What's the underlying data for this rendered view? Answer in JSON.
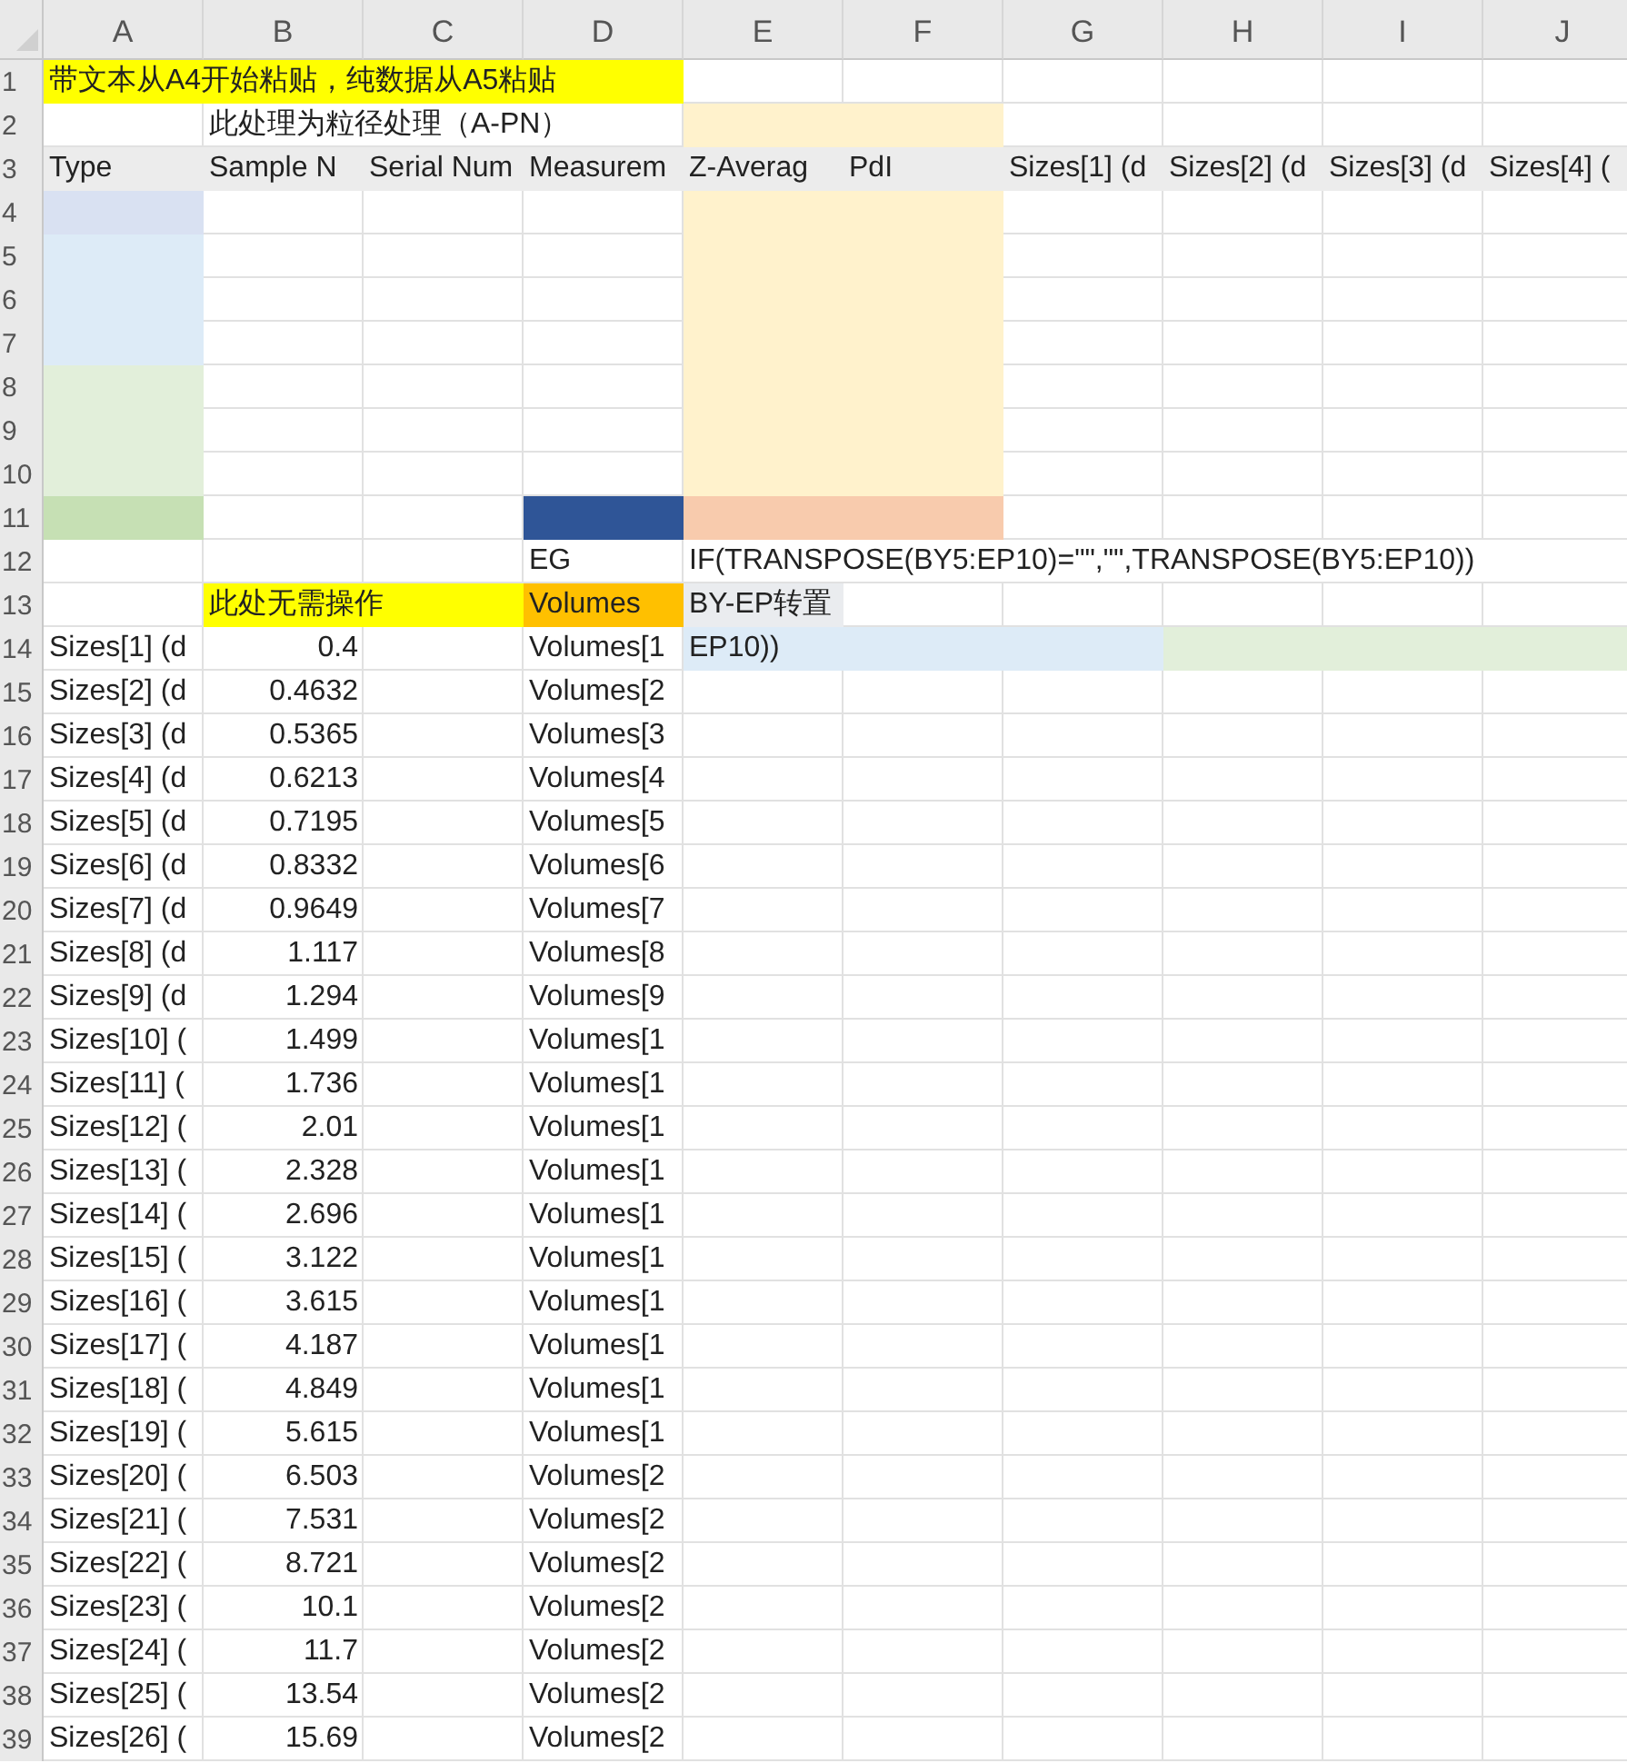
{
  "columns": [
    "A",
    "B",
    "C",
    "D",
    "E",
    "F",
    "G",
    "H",
    "I",
    "J"
  ],
  "rows": [
    {
      "label": "1",
      "cells": [
        {
          "text": "带文本从A4开始粘贴，纯数据从A5粘贴",
          "color": "#ffff00"
        },
        {
          "color": "#ffff00"
        },
        {
          "color": "#ffff00"
        },
        {
          "color": "#ffff00"
        },
        {},
        {},
        {},
        {},
        {},
        {}
      ]
    },
    {
      "label": "2",
      "cells": [
        {},
        {
          "text": "此处理为粒径处理（A-PN）"
        },
        {},
        {},
        {
          "color": "#fff2cc"
        },
        {
          "color": "#fff2cc"
        },
        {},
        {},
        {},
        {}
      ]
    },
    {
      "label": "3",
      "cells": [
        {
          "text": "Type",
          "color": "#ececec"
        },
        {
          "text": "Sample N",
          "color": "#ececec"
        },
        {
          "text": "Serial Num",
          "color": "#ececec"
        },
        {
          "text": "Measurem",
          "color": "#ececec"
        },
        {
          "text": "Z-Averag",
          "color": "#ececec"
        },
        {
          "text": "PdI",
          "color": "#ececec"
        },
        {
          "text": "Sizes[1] (d",
          "color": "#ececec"
        },
        {
          "text": "Sizes[2] (d",
          "color": "#ececec"
        },
        {
          "text": "Sizes[3] (d",
          "color": "#ececec"
        },
        {
          "text": "Sizes[4] (",
          "color": "#ececec"
        }
      ]
    },
    {
      "label": "4",
      "cells": [
        {
          "color": "#d9e1f2"
        },
        {},
        {},
        {},
        {
          "color": "#fff2cc"
        },
        {
          "color": "#fff2cc"
        },
        {},
        {},
        {},
        {}
      ]
    },
    {
      "label": "5",
      "cells": [
        {
          "color": "#ddebf7"
        },
        {},
        {},
        {},
        {
          "color": "#fff2cc"
        },
        {
          "color": "#fff2cc"
        },
        {},
        {},
        {},
        {}
      ]
    },
    {
      "label": "6",
      "cells": [
        {
          "color": "#ddebf7"
        },
        {},
        {},
        {},
        {
          "color": "#fff2cc"
        },
        {
          "color": "#fff2cc"
        },
        {},
        {},
        {},
        {}
      ]
    },
    {
      "label": "7",
      "cells": [
        {
          "color": "#ddebf7"
        },
        {},
        {},
        {},
        {
          "color": "#fff2cc"
        },
        {
          "color": "#fff2cc"
        },
        {},
        {},
        {},
        {}
      ]
    },
    {
      "label": "8",
      "cells": [
        {
          "color": "#e2efda"
        },
        {},
        {},
        {},
        {
          "color": "#fff2cc"
        },
        {
          "color": "#fff2cc"
        },
        {},
        {},
        {},
        {}
      ]
    },
    {
      "label": "9",
      "cells": [
        {
          "color": "#e2efda"
        },
        {},
        {},
        {},
        {
          "color": "#fff2cc"
        },
        {
          "color": "#fff2cc"
        },
        {},
        {},
        {},
        {}
      ]
    },
    {
      "label": "10",
      "cells": [
        {
          "color": "#e2efda"
        },
        {},
        {},
        {},
        {
          "color": "#fff2cc"
        },
        {
          "color": "#fff2cc"
        },
        {},
        {},
        {},
        {}
      ]
    },
    {
      "label": "11",
      "cells": [
        {
          "color": "#c6e0b4"
        },
        {},
        {},
        {
          "color": "#2f5597"
        },
        {
          "color": "#f8cbad"
        },
        {
          "color": "#f8cbad"
        },
        {},
        {},
        {},
        {}
      ]
    },
    {
      "label": "12",
      "cells": [
        {},
        {},
        {},
        {
          "text": "EG"
        },
        {
          "text": "IF(TRANSPOSE(BY5:EP10)=\"\",\"\",TRANSPOSE(BY5:EP10))"
        },
        {},
        {},
        {},
        {},
        {}
      ]
    },
    {
      "label": "13",
      "cells": [
        {},
        {
          "text": "此处无需操作",
          "color": "#ffff00"
        },
        {
          "color": "#ffff00"
        },
        {
          "text": "Volumes",
          "color": "#ffc000"
        },
        {
          "text": "BY-EP转置",
          "color": "#eaecef"
        },
        {},
        {},
        {},
        {},
        {}
      ]
    },
    {
      "label": "14",
      "cells": [
        {
          "text": "Sizes[1] (d"
        },
        {
          "text": "0.4",
          "numeric": true
        },
        {},
        {
          "text": "Volumes[1"
        },
        {
          "text": "EP10))",
          "color": "#ddebf7"
        },
        {
          "color": "#ddebf7"
        },
        {
          "color": "#ddebf7"
        },
        {
          "color": "#e2efda"
        },
        {
          "color": "#e2efda"
        },
        {
          "color": "#e2efda"
        }
      ]
    },
    {
      "label": "15",
      "cells": [
        {
          "text": "Sizes[2] (d"
        },
        {
          "text": "0.4632",
          "numeric": true
        },
        {},
        {
          "text": "Volumes[2"
        },
        {},
        {},
        {},
        {},
        {},
        {}
      ]
    },
    {
      "label": "16",
      "cells": [
        {
          "text": "Sizes[3] (d"
        },
        {
          "text": "0.5365",
          "numeric": true
        },
        {},
        {
          "text": "Volumes[3"
        },
        {},
        {},
        {},
        {},
        {},
        {}
      ]
    },
    {
      "label": "17",
      "cells": [
        {
          "text": "Sizes[4] (d"
        },
        {
          "text": "0.6213",
          "numeric": true
        },
        {},
        {
          "text": "Volumes[4"
        },
        {},
        {},
        {},
        {},
        {},
        {}
      ]
    },
    {
      "label": "18",
      "cells": [
        {
          "text": "Sizes[5] (d"
        },
        {
          "text": "0.7195",
          "numeric": true
        },
        {},
        {
          "text": "Volumes[5"
        },
        {},
        {},
        {},
        {},
        {},
        {}
      ]
    },
    {
      "label": "19",
      "cells": [
        {
          "text": "Sizes[6] (d"
        },
        {
          "text": "0.8332",
          "numeric": true
        },
        {},
        {
          "text": "Volumes[6"
        },
        {},
        {},
        {},
        {},
        {},
        {}
      ]
    },
    {
      "label": "20",
      "cells": [
        {
          "text": "Sizes[7] (d"
        },
        {
          "text": "0.9649",
          "numeric": true
        },
        {},
        {
          "text": "Volumes[7"
        },
        {},
        {},
        {},
        {},
        {},
        {}
      ]
    },
    {
      "label": "21",
      "cells": [
        {
          "text": "Sizes[8] (d"
        },
        {
          "text": "1.117",
          "numeric": true
        },
        {},
        {
          "text": "Volumes[8"
        },
        {},
        {},
        {},
        {},
        {},
        {}
      ]
    },
    {
      "label": "22",
      "cells": [
        {
          "text": "Sizes[9] (d"
        },
        {
          "text": "1.294",
          "numeric": true
        },
        {},
        {
          "text": "Volumes[9"
        },
        {},
        {},
        {},
        {},
        {},
        {}
      ]
    },
    {
      "label": "23",
      "cells": [
        {
          "text": "Sizes[10] ("
        },
        {
          "text": "1.499",
          "numeric": true
        },
        {},
        {
          "text": "Volumes[1"
        },
        {},
        {},
        {},
        {},
        {},
        {}
      ]
    },
    {
      "label": "24",
      "cells": [
        {
          "text": "Sizes[11] ("
        },
        {
          "text": "1.736",
          "numeric": true
        },
        {},
        {
          "text": "Volumes[1"
        },
        {},
        {},
        {},
        {},
        {},
        {}
      ]
    },
    {
      "label": "25",
      "cells": [
        {
          "text": "Sizes[12] ("
        },
        {
          "text": "2.01",
          "numeric": true
        },
        {},
        {
          "text": "Volumes[1"
        },
        {},
        {},
        {},
        {},
        {},
        {}
      ]
    },
    {
      "label": "26",
      "cells": [
        {
          "text": "Sizes[13] ("
        },
        {
          "text": "2.328",
          "numeric": true
        },
        {},
        {
          "text": "Volumes[1"
        },
        {},
        {},
        {},
        {},
        {},
        {}
      ]
    },
    {
      "label": "27",
      "cells": [
        {
          "text": "Sizes[14] ("
        },
        {
          "text": "2.696",
          "numeric": true
        },
        {},
        {
          "text": "Volumes[1"
        },
        {},
        {},
        {},
        {},
        {},
        {}
      ]
    },
    {
      "label": "28",
      "cells": [
        {
          "text": "Sizes[15] ("
        },
        {
          "text": "3.122",
          "numeric": true
        },
        {},
        {
          "text": "Volumes[1"
        },
        {},
        {},
        {},
        {},
        {},
        {}
      ]
    },
    {
      "label": "29",
      "cells": [
        {
          "text": "Sizes[16] ("
        },
        {
          "text": "3.615",
          "numeric": true
        },
        {},
        {
          "text": "Volumes[1"
        },
        {},
        {},
        {},
        {},
        {},
        {}
      ]
    },
    {
      "label": "30",
      "cells": [
        {
          "text": "Sizes[17] ("
        },
        {
          "text": "4.187",
          "numeric": true
        },
        {},
        {
          "text": "Volumes[1"
        },
        {},
        {},
        {},
        {},
        {},
        {}
      ]
    },
    {
      "label": "31",
      "cells": [
        {
          "text": "Sizes[18] ("
        },
        {
          "text": "4.849",
          "numeric": true
        },
        {},
        {
          "text": "Volumes[1"
        },
        {},
        {},
        {},
        {},
        {},
        {}
      ]
    },
    {
      "label": "32",
      "cells": [
        {
          "text": "Sizes[19] ("
        },
        {
          "text": "5.615",
          "numeric": true
        },
        {},
        {
          "text": "Volumes[1"
        },
        {},
        {},
        {},
        {},
        {},
        {}
      ]
    },
    {
      "label": "33",
      "cells": [
        {
          "text": "Sizes[20] ("
        },
        {
          "text": "6.503",
          "numeric": true
        },
        {},
        {
          "text": "Volumes[2"
        },
        {},
        {},
        {},
        {},
        {},
        {}
      ]
    },
    {
      "label": "34",
      "cells": [
        {
          "text": "Sizes[21] ("
        },
        {
          "text": "7.531",
          "numeric": true
        },
        {},
        {
          "text": "Volumes[2"
        },
        {},
        {},
        {},
        {},
        {},
        {}
      ]
    },
    {
      "label": "35",
      "cells": [
        {
          "text": "Sizes[22] ("
        },
        {
          "text": "8.721",
          "numeric": true
        },
        {},
        {
          "text": "Volumes[2"
        },
        {},
        {},
        {},
        {},
        {},
        {}
      ]
    },
    {
      "label": "36",
      "cells": [
        {
          "text": "Sizes[23] ("
        },
        {
          "text": "10.1",
          "numeric": true
        },
        {},
        {
          "text": "Volumes[2"
        },
        {},
        {},
        {},
        {},
        {},
        {}
      ]
    },
    {
      "label": "37",
      "cells": [
        {
          "text": "Sizes[24] ("
        },
        {
          "text": "11.7",
          "numeric": true
        },
        {},
        {
          "text": "Volumes[2"
        },
        {},
        {},
        {},
        {},
        {},
        {}
      ]
    },
    {
      "label": "38",
      "cells": [
        {
          "text": "Sizes[25] ("
        },
        {
          "text": "13.54",
          "numeric": true
        },
        {},
        {
          "text": "Volumes[2"
        },
        {},
        {},
        {},
        {},
        {},
        {}
      ]
    },
    {
      "label": "39",
      "cells": [
        {
          "text": "Sizes[26] ("
        },
        {
          "text": "15.69",
          "numeric": true
        },
        {},
        {
          "text": "Volumes[2"
        },
        {},
        {},
        {},
        {},
        {},
        {}
      ]
    }
  ]
}
